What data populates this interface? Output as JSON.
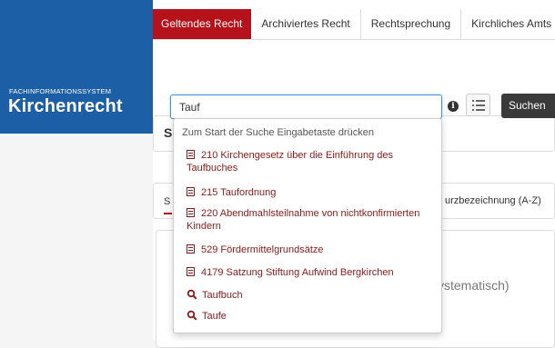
{
  "brand": {
    "subtitle": "FACHINFORMATIONSSYSTEM",
    "title": "Kirchenrecht"
  },
  "tabs": [
    {
      "label": "Geltendes Recht",
      "active": true
    },
    {
      "label": "Archiviertes Recht",
      "active": false
    },
    {
      "label": "Rechtsprechung",
      "active": false
    },
    {
      "label": "Kirchliches Amts",
      "active": false
    }
  ],
  "search": {
    "value": "Tauf",
    "button_label": "Suchen",
    "info_icon": "info-icon",
    "list_icon": "list-icon"
  },
  "dropdown": {
    "hint": "Zum Start der Suche Eingabetaste drücken",
    "documents": [
      "210 Kirchengesetz über die Einführung des Taufbuches",
      "215 Taufordnung",
      "220 Abendmahlsteilnahme von nichtkonfirmierten Kindern",
      "529 Fördermittelgrundsätze",
      "4179 Satzung Stiftung Aufwind Bergkirchen"
    ],
    "suggestions": [
      "Taufbuch",
      "Taufe"
    ]
  },
  "background": {
    "card1_initial": "S",
    "card2_initial": "S",
    "card2_text": "urzbezeichnung (A-Z)",
    "card3_text": "ystematisch)"
  },
  "colors": {
    "brand_blue": "#1d5fa6",
    "accent_red": "#b5121b",
    "link_red": "#8b1a1a"
  }
}
